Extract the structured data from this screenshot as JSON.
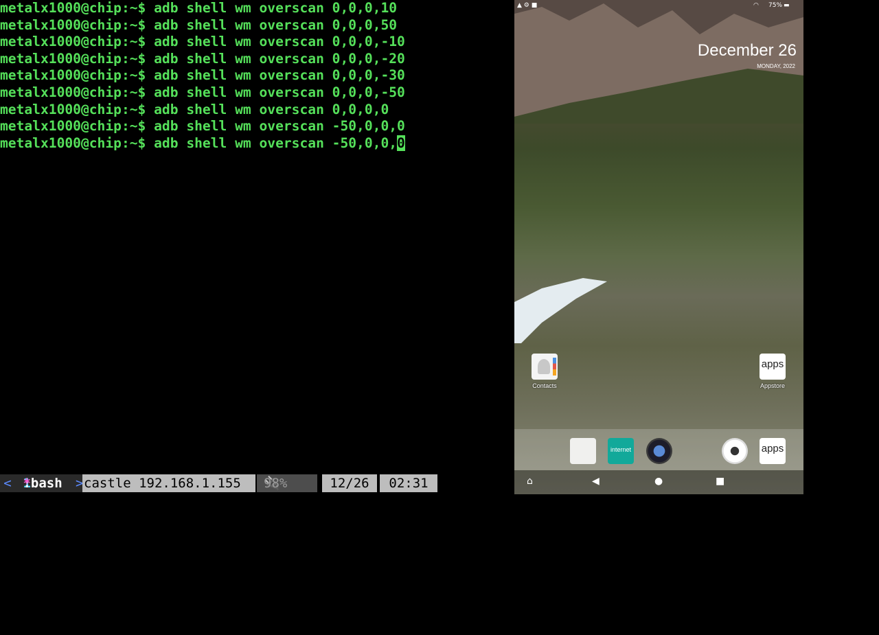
{
  "terminal": {
    "prompt": "metalx1000@chip:~$",
    "lines": [
      "adb shell wm overscan 0,0,0,10",
      "adb shell wm overscan 0,0,0,50",
      "adb shell wm overscan 0,0,0,-10",
      "adb shell wm overscan 0,0,0,-20",
      "adb shell wm overscan 0,0,0,-30",
      "adb shell wm overscan 0,0,0,-50",
      "adb shell wm overscan 0,0,0,0",
      "adb shell wm overscan -50,0,0,0"
    ],
    "current_input": "adb shell wm overscan -50,0,0,",
    "cursor_char": "0"
  },
  "tmux": {
    "left_marker": "<",
    "window_num": "1",
    "window_name": ":bash",
    "window_flag": "*",
    "right_marker": ">",
    "host": "castle 192.168.1.155",
    "battery": "98%",
    "date": "12/26",
    "time": "02:31"
  },
  "phone": {
    "status": {
      "battery": "75%"
    },
    "clock": {
      "date": "December 26",
      "day": "MONDAY, 2022"
    },
    "apps": [
      {
        "label": "Contacts",
        "icon": "contacts-icon"
      },
      {
        "label": "Appstore",
        "icon": "appstore-icon",
        "text": "apps"
      }
    ],
    "dock": [
      {
        "icon": "docs-icon"
      },
      {
        "icon": "silk-browser-icon",
        "text": "internet"
      },
      {
        "icon": "music-speaker-icon"
      },
      {
        "icon": "camera-shutter-icon"
      },
      {
        "icon": "appstore-icon",
        "text": "apps"
      }
    ]
  },
  "colors": {
    "terminal_green": "#55e05a",
    "tmux_gray": "#bdbdbd"
  }
}
